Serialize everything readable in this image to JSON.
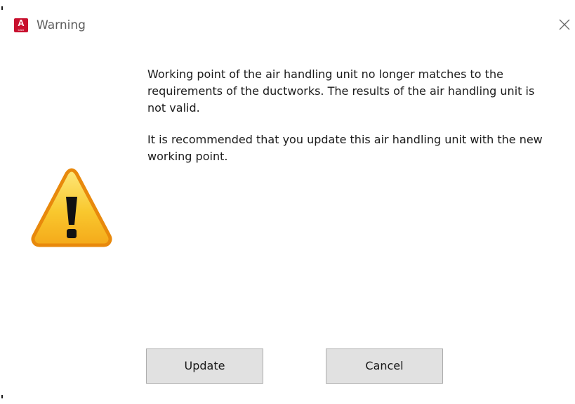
{
  "window": {
    "title": "Warning",
    "app_icon_letter": "A",
    "app_icon_sub": "CAD"
  },
  "message": {
    "paragraph_1": "Working point of the air handling unit no longer matches to the requirements of the ductworks. The results of the air handling unit is not valid.",
    "paragraph_2": "It is recommended that you update this air handling unit with the new working point."
  },
  "buttons": {
    "update_label": "Update",
    "cancel_label": "Cancel"
  },
  "icons": {
    "app": "autocad-app-icon",
    "close": "close-icon",
    "warning": "warning-icon"
  },
  "colors": {
    "app_icon": "#c8102e",
    "warning_fill": "#f9c82e",
    "warning_border": "#e8890c",
    "button_face": "#e1e1e1",
    "button_border": "#adadad"
  }
}
